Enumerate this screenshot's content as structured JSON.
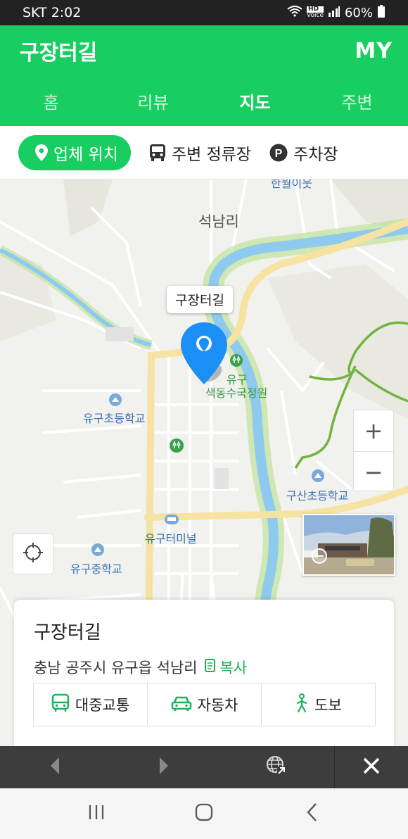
{
  "status": {
    "carrier_time": "SKT 2:02",
    "hd_label": "HD",
    "voice_label": "Voice",
    "battery": "60%"
  },
  "header": {
    "title": "구장터길",
    "my_label": "MY"
  },
  "tabs": [
    {
      "label": "홈",
      "active": false
    },
    {
      "label": "리뷰",
      "active": false
    },
    {
      "label": "지도",
      "active": true
    },
    {
      "label": "주변",
      "active": false
    }
  ],
  "subtabs": {
    "location": "업체 위치",
    "stops": "주변 정류장",
    "parking": "주차장"
  },
  "map": {
    "labels": {
      "top_place": "한월이웃",
      "village": "석남리",
      "park_1": "유구",
      "park_2": "색동수국정원",
      "school1": "유구초등학교",
      "school2": "구산초등학교",
      "terminal": "유구터미널",
      "school3": "유구중학교"
    },
    "callout": "구장터길",
    "zoom_in": "+",
    "zoom_out": "−"
  },
  "card": {
    "name": "구장터길",
    "address": "충남 공주시 유구읍 석남리",
    "copy": "복사",
    "routes": {
      "transit": "대중교통",
      "car": "자동차",
      "walk": "도보"
    }
  },
  "colors": {
    "brand": "#19ce60",
    "pin": "#1a8ff5",
    "road": "#f6e3a1",
    "river": "#8ec9ee",
    "trail": "#72b340"
  },
  "icons": [
    "pin-icon",
    "bus-icon",
    "parking-icon",
    "locate-icon",
    "copy-icon",
    "car-icon",
    "walk-icon",
    "back-icon",
    "forward-icon",
    "globe-icon",
    "close-icon",
    "recent-apps-icon",
    "home-icon",
    "nav-back-icon"
  ]
}
